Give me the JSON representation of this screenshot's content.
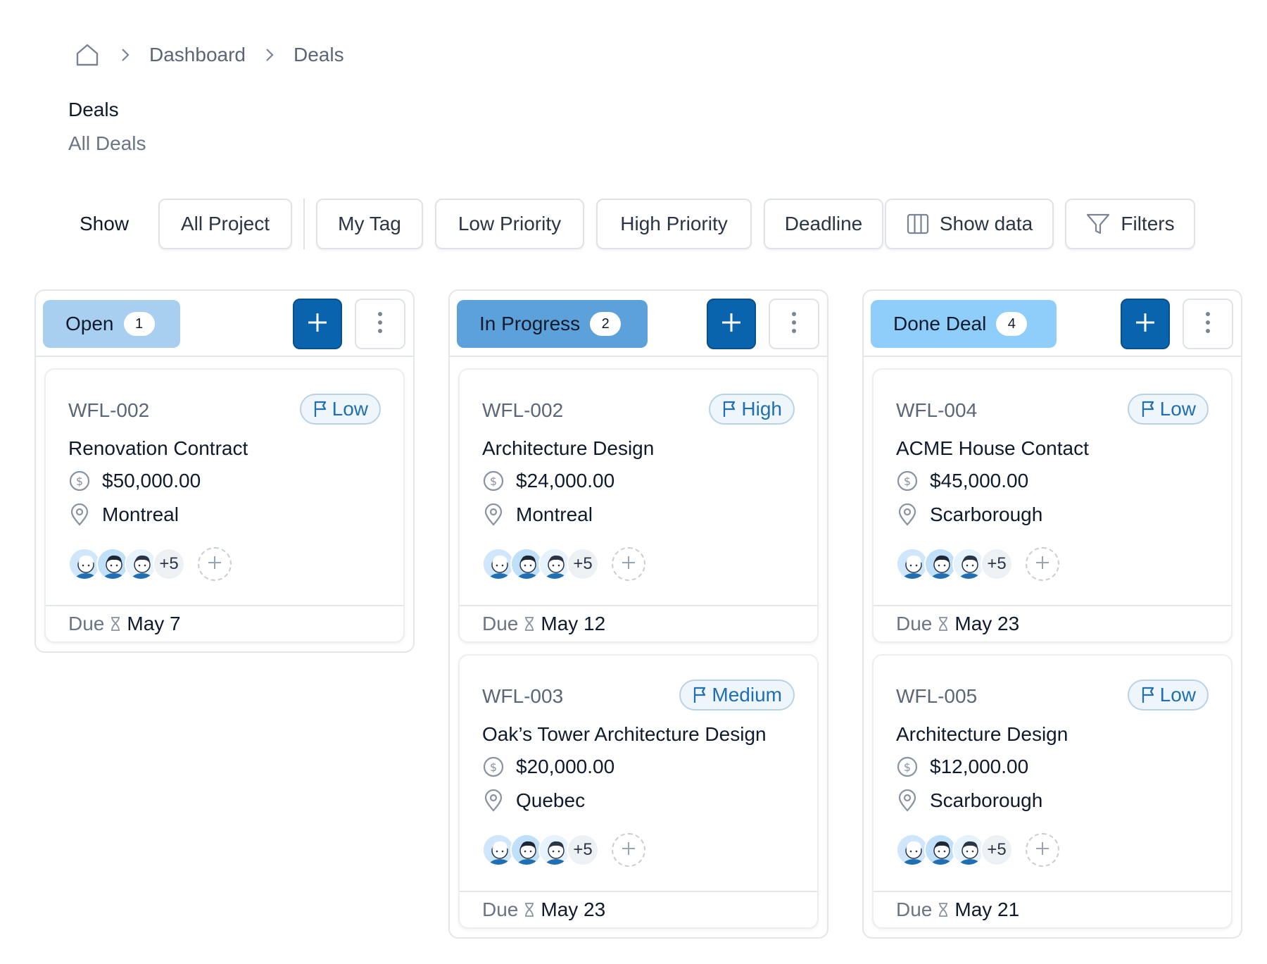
{
  "breadcrumb": {
    "items": [
      "Dashboard",
      "Deals"
    ]
  },
  "page": {
    "title": "Deals",
    "subtitle": "All Deals"
  },
  "filters": {
    "show_label": "Show",
    "chips": [
      "All Project",
      "My Tag",
      "Low Priority",
      "High Priority",
      "Deadline"
    ],
    "show_data": "Show data",
    "filters": "Filters"
  },
  "colors": {
    "accent": "#0a63ad",
    "open_pill": "#a9cff0",
    "in_progress_pill": "#5da1db",
    "done_pill": "#8fcefb"
  },
  "columns": [
    {
      "title": "Open",
      "count": "1",
      "cards": [
        {
          "id": "WFL-002",
          "priority": "Low",
          "title": "Renovation Contract",
          "amount": "$50,000.00",
          "location": "Montreal",
          "extra": "+5",
          "due_label": "Due",
          "due": "May 7"
        }
      ]
    },
    {
      "title": "In Progress",
      "count": "2",
      "cards": [
        {
          "id": "WFL-002",
          "priority": "High",
          "title": "Architecture Design",
          "amount": "$24,000.00",
          "location": "Montreal",
          "extra": "+5",
          "due_label": "Due",
          "due": "May 12"
        },
        {
          "id": "WFL-003",
          "priority": "Medium",
          "title": "Oak’s Tower Architecture Design",
          "amount": "$20,000.00",
          "location": "Quebec",
          "extra": "+5",
          "due_label": "Due",
          "due": "May 23"
        }
      ]
    },
    {
      "title": "Done Deal",
      "count": "4",
      "cards": [
        {
          "id": "WFL-004",
          "priority": "Low",
          "title": "ACME House Contact",
          "amount": "$45,000.00",
          "location": "Scarborough",
          "extra": "+5",
          "due_label": "Due",
          "due": "May 23"
        },
        {
          "id": "WFL-005",
          "priority": "Low",
          "title": "Architecture Design",
          "amount": "$12,000.00",
          "location": "Scarborough",
          "extra": "+5",
          "due_label": "Due",
          "due": "May 21"
        }
      ]
    }
  ]
}
